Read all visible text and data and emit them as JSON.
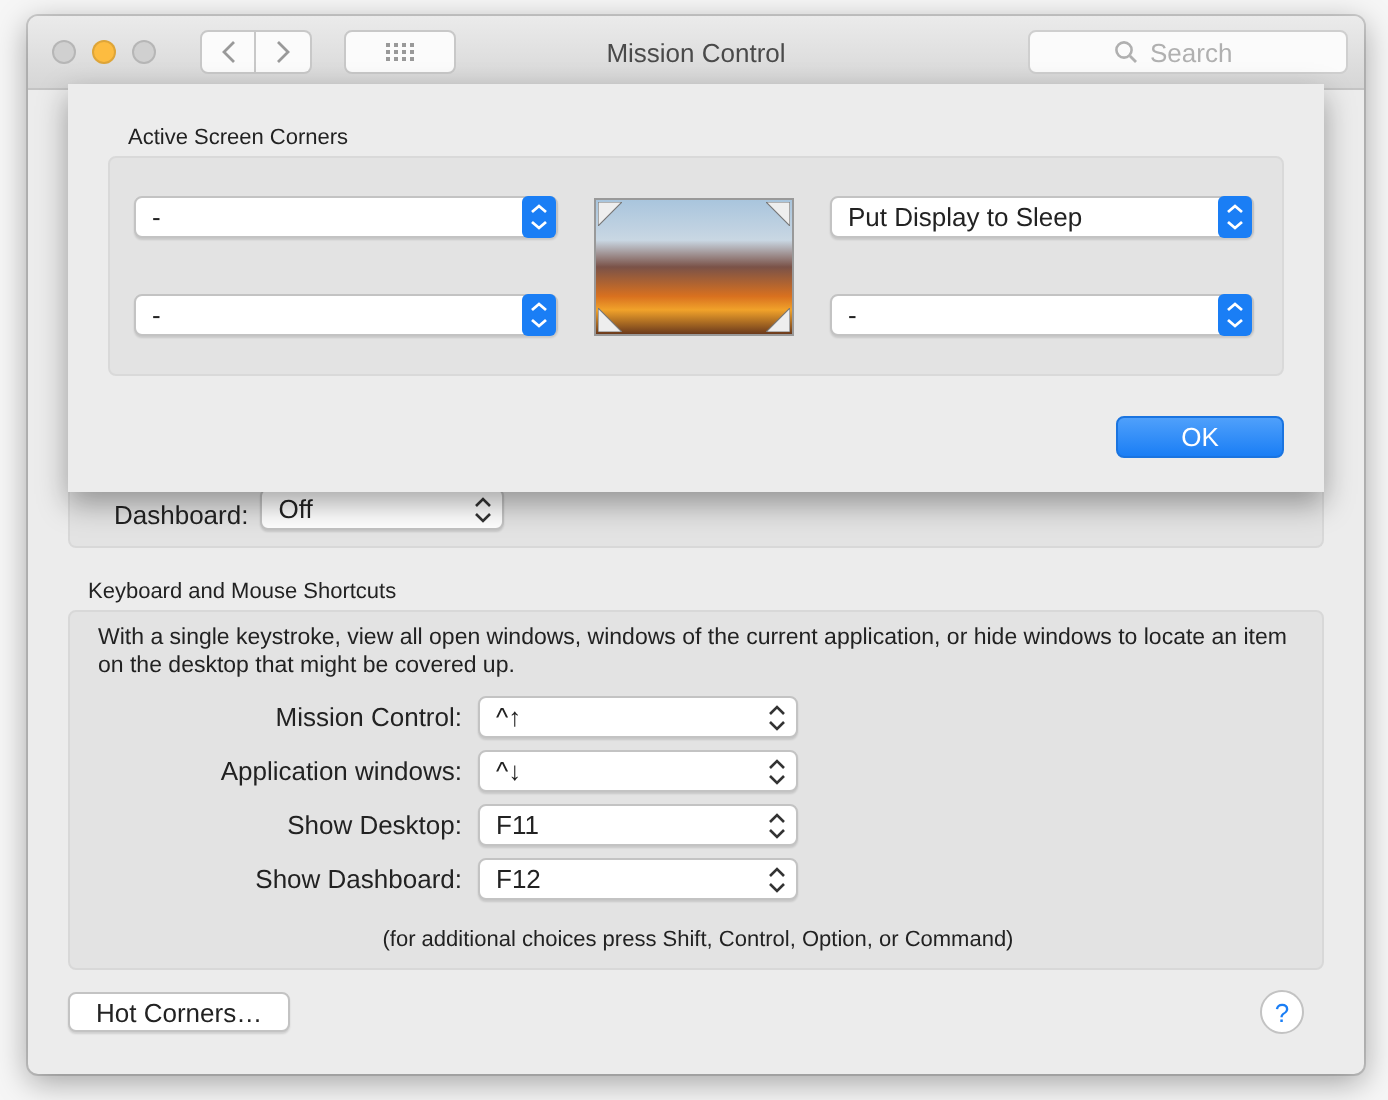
{
  "window": {
    "title": "Mission Control",
    "search": {
      "placeholder": "Search"
    }
  },
  "dashboard": {
    "label": "Dashboard:",
    "value": "Off"
  },
  "shortcuts": {
    "title": "Keyboard and Mouse Shortcuts",
    "description": "With a single keystroke, view all open windows, windows of the current application, or hide windows to locate an item on the desktop that might be covered up.",
    "rows": [
      {
        "label": "Mission Control:",
        "value": "^↑"
      },
      {
        "label": "Application windows:",
        "value": "^↓"
      },
      {
        "label": "Show Desktop:",
        "value": "F11"
      },
      {
        "label": "Show Dashboard:",
        "value": "F12"
      }
    ],
    "note": "(for additional choices press Shift, Control, Option, or Command)"
  },
  "hot_corners_button": "Hot Corners…",
  "help_button": "?",
  "sheet": {
    "title": "Active Screen Corners",
    "corners": [
      {
        "value": "-"
      },
      {
        "value": "Put Display to Sleep"
      },
      {
        "value": "-"
      },
      {
        "value": "-"
      }
    ],
    "ok_button": "OK"
  }
}
